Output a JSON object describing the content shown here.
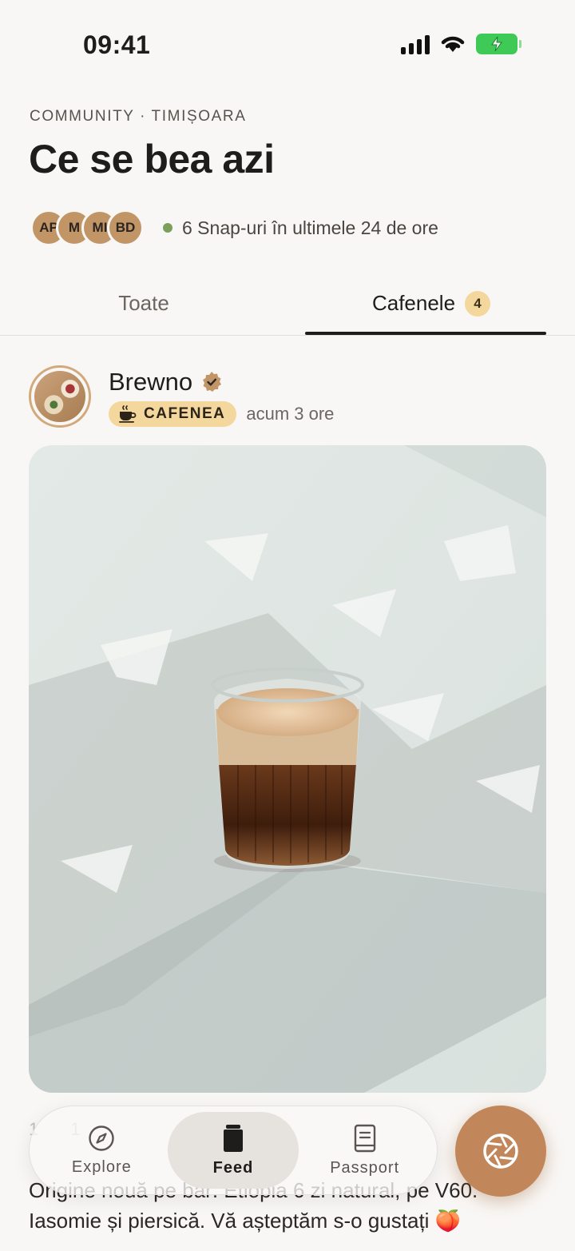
{
  "status_bar": {
    "time": "09:41"
  },
  "header": {
    "eyebrow": "COMMUNITY · TIMIȘOARA",
    "title": "Ce se bea azi",
    "members": [
      "AP",
      "M",
      "MI",
      "BD"
    ],
    "activity": "6 Snap-uri în ultimele 24 de ore"
  },
  "tabs": [
    {
      "label": "Toate",
      "active": false
    },
    {
      "label": "Cafenele",
      "active": true,
      "badge": "4"
    }
  ],
  "post": {
    "author": "Brewno",
    "verified": true,
    "category": "CAFENEA",
    "category_icon": "coffee-cup-icon",
    "time": "acum 3 ore",
    "reactions": {
      "likes": "1",
      "comments": "1"
    },
    "caption": "Origine nouă pe bar: Etiopia 6 zi natural, pe V60. Iasomie și piersică. Vă așteptăm s-o gustați 🍑"
  },
  "nav": {
    "items": [
      {
        "label": "Explore",
        "icon": "compass-icon",
        "active": false
      },
      {
        "label": "Feed",
        "icon": "cup-icon",
        "active": true
      },
      {
        "label": "Passport",
        "icon": "book-icon",
        "active": false
      }
    ],
    "fab_icon": "camera-shutter-icon"
  },
  "colors": {
    "background": "#f9f7f5",
    "accent": "#c1875b",
    "badge": "#f4d79c",
    "live": "#7ba05b"
  }
}
